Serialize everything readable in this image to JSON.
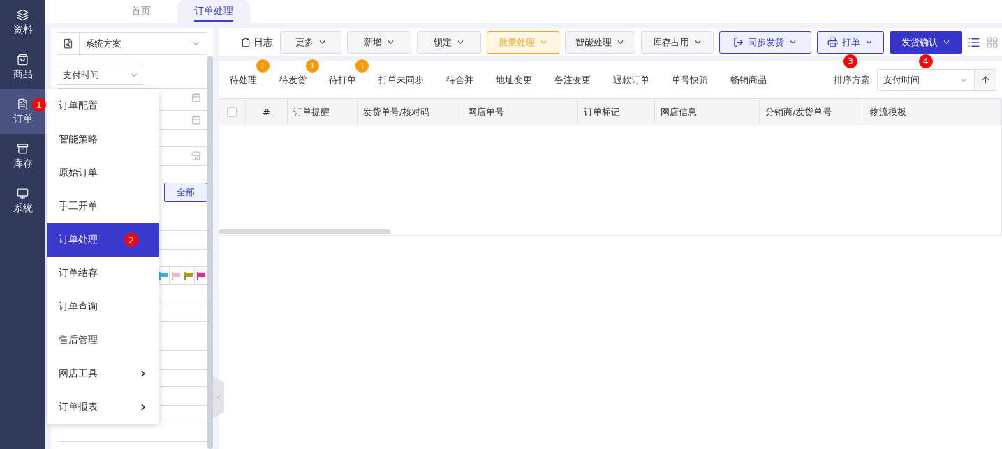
{
  "sidebar": {
    "items": [
      {
        "label": "资料",
        "selected": false
      },
      {
        "label": "商品",
        "selected": false
      },
      {
        "label": "订单",
        "selected": true,
        "annotation": "1"
      },
      {
        "label": "库存",
        "selected": false
      },
      {
        "label": "系统",
        "selected": false
      }
    ]
  },
  "page_tabs": [
    {
      "label": "首页",
      "selected": false
    },
    {
      "label": "订单处理",
      "selected": true
    }
  ],
  "filter_panel": {
    "scheme_select": "系统方案",
    "time_select": "支付时间",
    "all_button": "全部",
    "flags": [
      {
        "color": "#3ab0e6"
      },
      {
        "color": "#f0b8bc"
      },
      {
        "color": "#a0a010"
      },
      {
        "color": "#e8288c"
      }
    ]
  },
  "menu": {
    "items": [
      {
        "label": "订单配置",
        "selected": false,
        "submenu": false
      },
      {
        "label": "智能策略",
        "selected": false,
        "submenu": false
      },
      {
        "label": "原始订单",
        "selected": false,
        "submenu": false
      },
      {
        "label": "手工开单",
        "selected": false,
        "submenu": false
      },
      {
        "label": "订单处理",
        "selected": true,
        "submenu": false,
        "annotation": "2"
      },
      {
        "label": "订单结存",
        "selected": false,
        "submenu": false
      },
      {
        "label": "订单查询",
        "selected": false,
        "submenu": false
      },
      {
        "label": "售后管理",
        "selected": false,
        "submenu": false
      },
      {
        "label": "网店工具",
        "selected": false,
        "submenu": true
      },
      {
        "label": "订单报表",
        "selected": false,
        "submenu": true
      }
    ]
  },
  "toolbar": {
    "log": "日志",
    "buttons": [
      {
        "label": "更多",
        "kind": "plain"
      },
      {
        "label": "新增",
        "kind": "plain"
      },
      {
        "label": "锁定",
        "kind": "plain"
      },
      {
        "label": "批量处理",
        "kind": "warning"
      },
      {
        "label": "智能处理",
        "kind": "plain"
      },
      {
        "label": "库存占用",
        "kind": "plain"
      },
      {
        "label": "同步发货",
        "kind": "outline"
      },
      {
        "label": "打单",
        "kind": "outline",
        "annotation": "3"
      },
      {
        "label": "发货确认",
        "kind": "primary",
        "annotation": "4"
      }
    ],
    "views": [
      {
        "selected": true
      },
      {
        "selected": false
      }
    ]
  },
  "status_tabs": [
    {
      "label": "待处理",
      "count": "1"
    },
    {
      "label": "待发货",
      "count": "1"
    },
    {
      "label": "待打单",
      "count": "1"
    },
    {
      "label": "打单未同步"
    },
    {
      "label": "待合并"
    },
    {
      "label": "地址变更"
    },
    {
      "label": "备注变更"
    },
    {
      "label": "退款订单"
    },
    {
      "label": "单号快筛"
    },
    {
      "label": "畅销商品"
    }
  ],
  "sort": {
    "label": "排序方案:",
    "value": "支付时间"
  },
  "table": {
    "select_all_checked": false,
    "columns": [
      "#",
      "订单提醒",
      "发货单号/核对码",
      "网店单号",
      "订单标记",
      "网店信息",
      "分销商/发货单号",
      "物流模板"
    ]
  }
}
